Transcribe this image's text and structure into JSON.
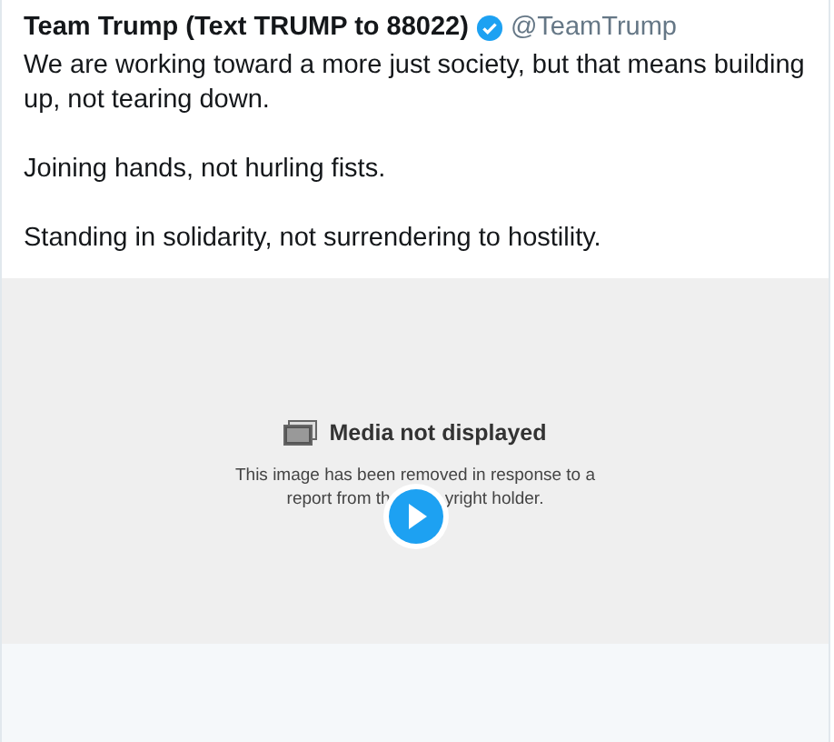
{
  "tweet": {
    "name": "Team Trump (Text TRUMP to 88022)",
    "verified": true,
    "handle": "@TeamTrump",
    "paragraphs": [
      "We are working toward a more just society, but that means building up, not tearing down.",
      "Joining hands, not hurling fists.",
      "Standing in solidarity, not surrendering to hostility."
    ]
  },
  "media": {
    "title": "Media not displayed",
    "message": "This image has been removed in response to a",
    "message_left": "report from th",
    "message_right": "yright holder."
  }
}
